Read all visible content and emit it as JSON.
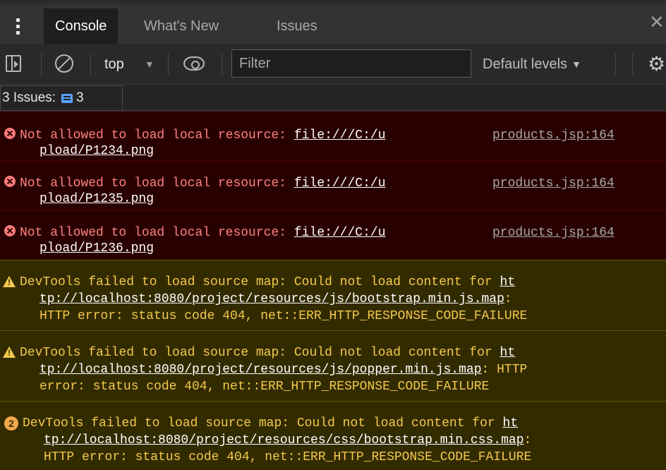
{
  "tabs": [
    {
      "label": "Console",
      "active": true
    },
    {
      "label": "What's New",
      "active": false
    },
    {
      "label": "Issues",
      "active": false
    }
  ],
  "toolbar": {
    "context": "top",
    "filter_placeholder": "Filter",
    "levels_label": "Default levels"
  },
  "issues": {
    "label": "3 Issues:",
    "count": "3"
  },
  "messages": [
    {
      "type": "error",
      "text": "Not allowed to load local resource: ",
      "link": "file:///C:/u",
      "source": "products.jsp:164",
      "cont": "pload/P1234.png"
    },
    {
      "type": "error",
      "text": "Not allowed to load local resource: ",
      "link": "file:///C:/u",
      "source": "products.jsp:164",
      "cont": "pload/P1235.png"
    },
    {
      "type": "error",
      "text": "Not allowed to load local resource: ",
      "link": "file:///C:/u",
      "source": "products.jsp:164",
      "cont": "pload/P1236.png"
    },
    {
      "type": "warning",
      "l1": "DevTools failed to load source map: Could not load content for ",
      "l1_link": "ht",
      "l2_link": "tp://localhost:8080/project/resources/js/bootstrap.min.js.map",
      "l2_rest": ":",
      "l3": "HTTP error: status code 404, net::ERR_HTTP_RESPONSE_CODE_FAILURE"
    },
    {
      "type": "warning",
      "l1": "DevTools failed to load source map: Could not load content for ",
      "l1_link": "ht",
      "l2_link": "tp://localhost:8080/project/resources/js/popper.min.js.map",
      "l2_rest": ": HTTP",
      "l3": "error: status code 404, net::ERR_HTTP_RESPONSE_CODE_FAILURE"
    },
    {
      "type": "warning",
      "repeat": "2",
      "l1": "DevTools failed to load source map: Could not load content for ",
      "l1_link": "ht",
      "l2_link": "tp://localhost:8080/project/resources/css/bootstrap.min.css.map",
      "l2_rest": ":",
      "l3": "HTTP error: status code 404, net::ERR_HTTP_RESPONSE_CODE_FAILURE"
    }
  ],
  "colors": {
    "error_bg": "#290000",
    "error_text": "#ff8080",
    "warning_bg": "#332b00",
    "warning_text": "#f2c94c",
    "issue_badge": "#5aa0ff"
  }
}
